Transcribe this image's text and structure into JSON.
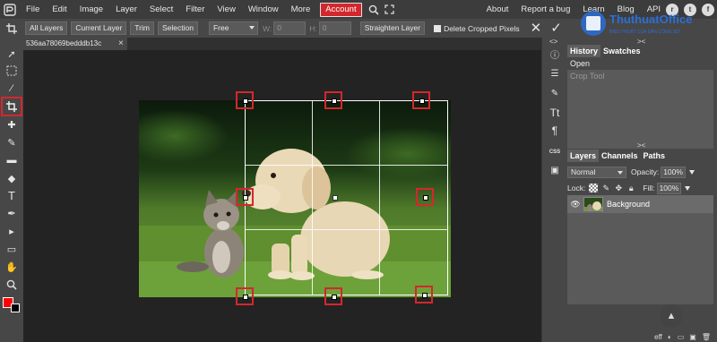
{
  "menu": {
    "items": [
      "File",
      "Edit",
      "Image",
      "Layer",
      "Select",
      "Filter",
      "View",
      "Window",
      "More"
    ],
    "account": "Account",
    "right_links": [
      "About",
      "Report a bug",
      "Learn",
      "Blog",
      "API"
    ]
  },
  "watermark": {
    "text": "ThuthuatOffice",
    "sub": "BIỂU THUẬT CỦA DÂN CÔNG SỞ"
  },
  "options": {
    "buttons": [
      "All Layers",
      "Current Layer",
      "Trim",
      "Selection"
    ],
    "ratio_value": "Free",
    "w_label": "W:",
    "w_value": "0",
    "h_label": "H:",
    "h_value": "0",
    "straighten": "Straighten Layer",
    "delete_cropped": "Delete Cropped Pixels"
  },
  "document": {
    "tab_name": "536aa78069bedddb13c",
    "close": "×"
  },
  "history": {
    "tabs": [
      "History",
      "Swatches"
    ],
    "items": [
      "Open",
      "Crop Tool"
    ]
  },
  "layers": {
    "tabs": [
      "Layers",
      "Channels",
      "Paths"
    ],
    "blend_mode": "Normal",
    "opacity_label": "Opacity:",
    "opacity_value": "100%",
    "lock_label": "Lock:",
    "fill_label": "Fill:",
    "fill_value": "100%",
    "items": [
      "Background"
    ],
    "footer_eff": "eff"
  },
  "colors": {
    "accent": "#d4272d",
    "foreground": "#ff0000",
    "background": "#000000"
  }
}
